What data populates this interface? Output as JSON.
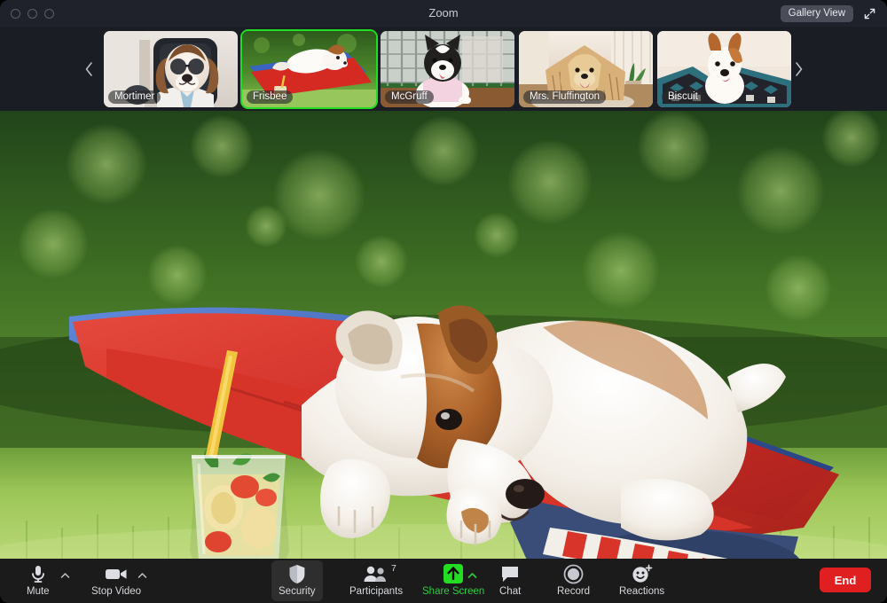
{
  "window": {
    "title": "Zoom",
    "traffic_lights": [
      "close",
      "minimize",
      "maximize"
    ]
  },
  "header": {
    "gallery_view_label": "Gallery View",
    "expand_icon": "expand-diagonal-icon"
  },
  "filmstrip": {
    "prev_icon": "chevron-left-icon",
    "next_icon": "chevron-right-icon",
    "participants": [
      {
        "name": "Mortimer",
        "active": false
      },
      {
        "name": "Frisbee",
        "active": true
      },
      {
        "name": "McGruff",
        "active": false
      },
      {
        "name": "Mrs. Fluffington",
        "active": false
      },
      {
        "name": "Biscuit",
        "active": false
      }
    ]
  },
  "stage": {
    "speaker": "Frisbee",
    "description": "Jack Russell terrier lying on a red and blue sun lounger on grass with a fruit drink in a glass"
  },
  "toolbar": {
    "mute": {
      "label": "Mute",
      "icon": "microphone-icon",
      "caret": "chevron-up-icon"
    },
    "video": {
      "label": "Stop Video",
      "icon": "video-camera-icon",
      "caret": "chevron-up-icon"
    },
    "security": {
      "label": "Security",
      "icon": "shield-icon",
      "highlighted": true
    },
    "participants": {
      "label": "Participants",
      "icon": "people-icon",
      "count": "7"
    },
    "share_screen": {
      "label": "Share Screen",
      "icon": "share-screen-up-arrow-icon",
      "caret": "chevron-up-icon"
    },
    "chat": {
      "label": "Chat",
      "icon": "chat-bubble-icon"
    },
    "record": {
      "label": "Record",
      "icon": "record-circle-icon"
    },
    "reactions": {
      "label": "Reactions",
      "icon": "smiley-plus-icon"
    },
    "end": {
      "label": "End"
    }
  },
  "colors": {
    "accent_green": "#2ecc40",
    "active_border": "#22dd22",
    "end_red": "#e02020",
    "toolbar_bg": "#1b1b1b",
    "titlebar_bg": "#20222b",
    "filmstrip_bg": "#1b1d24"
  }
}
